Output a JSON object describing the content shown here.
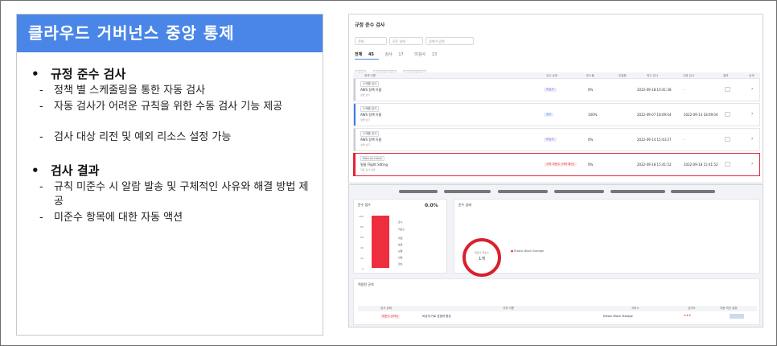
{
  "slide": {
    "title": "클라우드 거버넌스 중앙 통제",
    "bullet": "•",
    "dash": "-",
    "sections": [
      {
        "heading": "규정 준수 검사",
        "items": [
          "정책 별 스케줄링을 통한 자동 검사",
          "자동 검사가 어려운 규칙을 위한 수동 검사 기능 제공",
          "검사 대상 리전 및 예외 리소스 설정 가능"
        ]
      },
      {
        "heading": "검사 결과",
        "items": [
          "규칙 미준수 시 알람 발송 및 구체적인 사유와 해결 방법 제공",
          "미준수 항목에 대한 자동 액션"
        ]
      }
    ]
  },
  "compliance_list": {
    "title": "규정 준수 검사",
    "filters": [
      "전체",
      "모든 상태",
      "검색어 입력"
    ],
    "tabs": [
      {
        "label": "전체",
        "count": "45"
      },
      {
        "label": "검사",
        "count": "17"
      },
      {
        "label": "미검사",
        "count": "13"
      }
    ],
    "buttons": [
      "검사",
      "검사 대상 설정",
      "CSV 다운로드"
    ],
    "columns": [
      "정책 이름",
      "검사 상태",
      "준수율",
      "미흡함",
      "최근 검사",
      "다음 검사",
      "결과",
      "상세"
    ],
    "rows": [
      {
        "tag": "스케줄 검사",
        "name": "AWS 정책 이름",
        "sub": "설명 보기",
        "status": "미검사",
        "rate": "0%",
        "last": "2022-09-18 10:41:38",
        "next": "-",
        "bar": "#c9ccd3",
        "status_color": "#7a6ad8",
        "status_bg": "#ecebfb"
      },
      {
        "tag": "스케줄 검사",
        "name": "AWS 정책 이름",
        "sub": "설명 보기",
        "status": "검사",
        "rate": "100%",
        "last": "2022-09-07 18:09:04",
        "next": "2022-09-14 18:09:04",
        "bar": "#3b7de2",
        "status_color": "#3b7de2",
        "status_bg": "#e6efff"
      },
      {
        "tag": "스케줄 검사",
        "name": "AWS 정책 이름",
        "sub": "설명 보기",
        "status": "미검사",
        "rate": "0%",
        "last": "2022-09-14 15:43:27",
        "next": "-",
        "bar": "#c9ccd3",
        "status_color": "#7a6ad8",
        "status_bg": "#ecebfb"
      },
      {
        "tag": "Manual check",
        "name": "필름 Flight Sitting",
        "sub": "자동 검사 설정",
        "status": "규칙 미준수 (이력 확인)",
        "rate": "0%",
        "last": "2022-09-18 15:41:52",
        "next": "2022-09-18 15:41:52",
        "bar": "#e0243a",
        "status_color": "#e0243a",
        "status_bg": "#fdecee"
      }
    ]
  },
  "result_view": {
    "score_title": "준수 점수",
    "score": "0.0%",
    "y_ticks": [
      "100",
      "80",
      "60",
      "40",
      "20",
      "0"
    ],
    "legend": [
      "준수",
      "미준수",
      "위험",
      "높음",
      "보통",
      "낮음",
      "정보"
    ],
    "status_title": "준수 상태",
    "ring_label": "미준수 리소스",
    "ring_value": "1개",
    "resource": "Elastic Block Storage",
    "resources_title": "적용된 규칙",
    "table_cols": [
      "검사 상태",
      "규칙 이름",
      "서비스",
      "심각도",
      "자동 액션 설정"
    ],
    "table_row": {
      "status": "미준수 (이력)",
      "rule": "비공개 키로 암호화 활성",
      "service": "Elastic Block Storage",
      "severity": "★★★"
    }
  }
}
